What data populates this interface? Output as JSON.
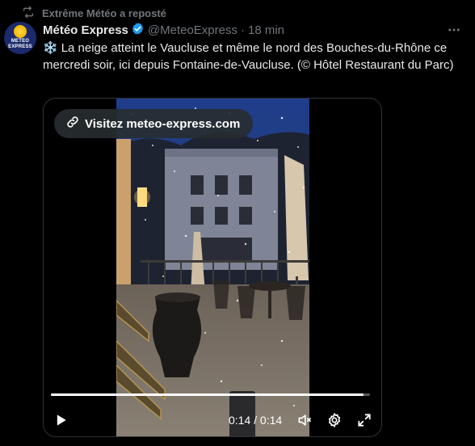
{
  "repost": {
    "icon": "repost-icon",
    "text": "Extrême Météo a reposté"
  },
  "author": {
    "avatar_text_1": "METEO",
    "avatar_text_2": "EXPRESS",
    "name": "Météo Express",
    "verified_icon": "verified-badge-icon",
    "handle": "@MeteoExpress",
    "separator": "·",
    "time": "18 min"
  },
  "more_icon": "more-horizontal-icon",
  "tweet": {
    "emoji": "❄️",
    "text": "La neige atteint le Vaucluse et même le nord des Bouches-du-Rhône ce mercredi soir, ici depuis Fontaine-de-Vaucluse. (© Hôtel Restaurant du Parc)"
  },
  "video": {
    "site_link": "Visitez meteo-express.com",
    "link_icon": "link-icon",
    "progress": 0.98,
    "time_current": "0:14",
    "time_separator": "/",
    "time_total": "0:14",
    "play_icon": "play-icon",
    "volume_icon": "volume-icon",
    "settings_icon": "gear-icon",
    "fullscreen_icon": "fullscreen-icon"
  },
  "colors": {
    "background": "#000000",
    "text": "#e7e9ea",
    "muted": "#71767b",
    "verified": "#1d9bf0",
    "border": "#2f3336"
  }
}
